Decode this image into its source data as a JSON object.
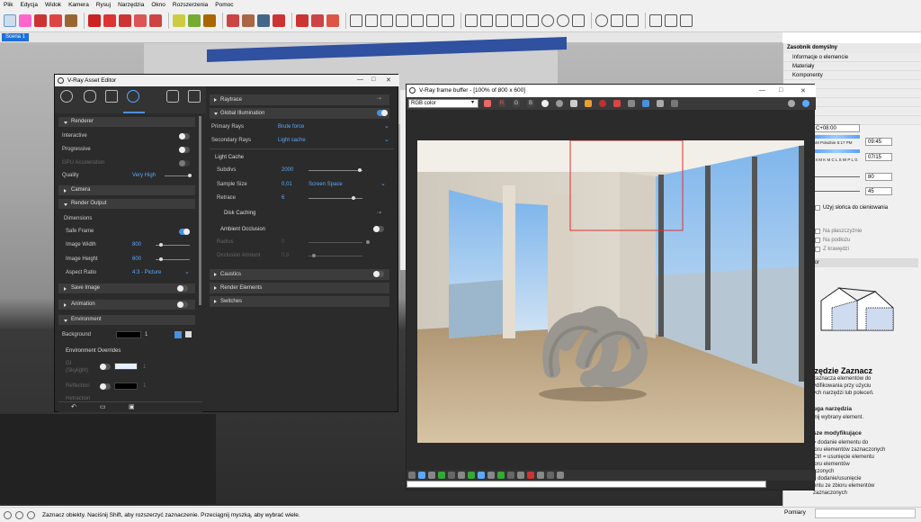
{
  "menu": [
    "Plik",
    "Edycja",
    "Widok",
    "Kamera",
    "Rysuj",
    "Narzędzia",
    "Okno",
    "Rozszerzenia",
    "Pomoc"
  ],
  "scene_tab": "Scena 1",
  "status": {
    "text": "Zaznacz obiekty. Naciśnij Shift, aby rozszerzyć zaznaczenie. Przeciągnij myszką, aby wybrać wiele.",
    "right": "Pomiary"
  },
  "tray": {
    "title": "Zasobnik domyślny",
    "sections": [
      "Informacje o elemencie",
      "Materiały",
      "Komponenty"
    ],
    "timezone": "C+08:00",
    "time_label": "AM Południe 5:17 PM",
    "time_value": "09:45",
    "date_value": "07/15",
    "months": "I II M K M C L S W P L G",
    "light_value": "80",
    "dark_value": "45",
    "use_sun": "Użyj słońca do cieniowania",
    "checks": [
      "Na płaszczyźnie",
      "Na podłożu",
      "Z krawędzi"
    ],
    "instructor_title_partial": "ktor",
    "tool_title": "rzędzie Zaznacz",
    "desc1": "zaznacza elementów do",
    "desc2": "ydifikowania przy użyciu",
    "desc3": "ych narzędzi lub poleceń.",
    "op_title": "uga narzędzia",
    "op1": "inij wybrany element.",
    "mod_title": "sze modyfikujące",
    "mod1": "= dodanie elementu do",
    "mod2": "ioru elementów zaznaczonych",
    "mod3": "Ctrl = usunięcie elementu",
    "mod4": "ioru elementów",
    "mod5": "iczonych",
    "mod6": "= dodanie/usunięcie",
    "mod7": "entu ze zbioru elementów",
    "mod8": "zaznaczonych"
  },
  "ae": {
    "title": "V-Ray Asset Editor",
    "left": {
      "renderer": "Renderer",
      "interactive": "Interactive",
      "progressive": "Progressive",
      "gpu": "GPU Acceleration",
      "quality": "Quality",
      "quality_val": "Very High",
      "camera": "Camera",
      "render_output": "Render Output",
      "dimensions": "Dimensions",
      "safe_frame": "Safe Frame",
      "image_width": "Image Width",
      "image_width_val": "800",
      "image_height": "Image Height",
      "image_height_val": "600",
      "aspect": "Aspect Ratio",
      "aspect_val": "4:3 - Picture",
      "save_image": "Save Image",
      "animation": "Animation",
      "environment": "Environment",
      "background": "Background",
      "bg_val": "1",
      "env_overrides": "Environment Overrides",
      "gi": "GI",
      "skylight": "(Skylight)",
      "gi_val": "1",
      "reflection": "Reflection",
      "refl_val": "1",
      "refraction": "Refraction",
      "refr_val": "1"
    },
    "right": {
      "raytrace": "Raytrace",
      "gi": "Global Illumination",
      "primary": "Primary Rays",
      "primary_val": "Brute force",
      "secondary": "Secondary Rays",
      "secondary_val": "Light cache",
      "light_cache": "Light Cache",
      "subdivs": "Subdivs",
      "subdivs_val": "2000",
      "sample_size": "Sample Size",
      "sample_size_val": "0,01",
      "screen_space": "Screen Space",
      "retrace": "Retrace",
      "retrace_val": "6",
      "disk_caching": "Disk Caching",
      "ao": "Ambient Occlusion",
      "radius": "Radius",
      "radius_val": "0",
      "occ_amount": "Occlusion Amount",
      "occ_val": "0,8",
      "caustics": "Caustics",
      "render_elements": "Render Elements",
      "switches": "Switches"
    }
  },
  "vfb": {
    "title": "V-Ray frame buffer - [100% of 800 x 600]",
    "channel": "RGB color",
    "r": "R",
    "g": "G",
    "b": "B"
  },
  "colors": {
    "accent": "#4a8fe0",
    "link": "#5aa9ff",
    "panel": "#2b2b2b",
    "region": "#e03030"
  }
}
